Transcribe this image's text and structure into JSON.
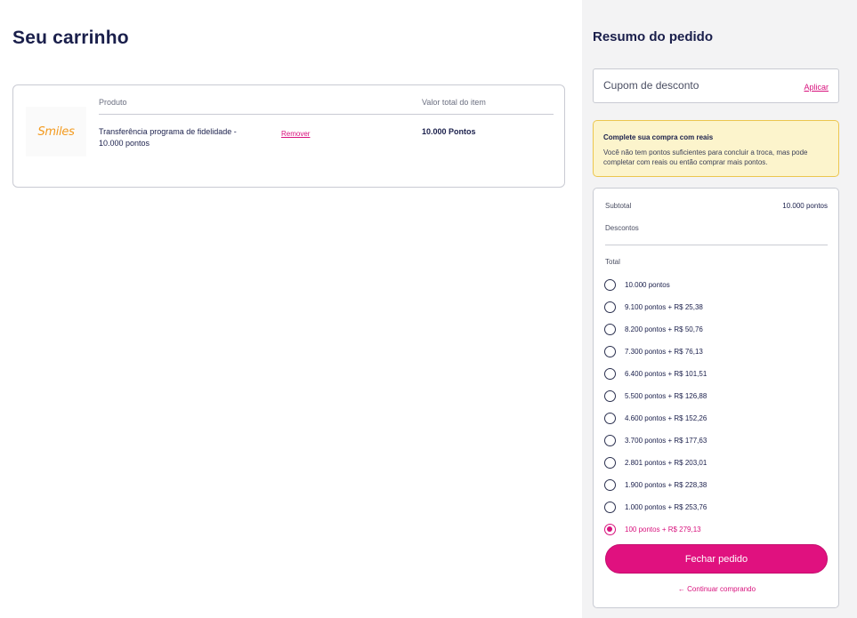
{
  "cart": {
    "title": "Seu carrinho",
    "logo": {
      "text": "Smiles",
      "icon": "smiles-logo",
      "color": "#f39a1e"
    },
    "columns": {
      "product": "Produto",
      "total": "Valor total do item"
    },
    "item": {
      "name": "Transferência programa de fidelidade - 10.000 pontos",
      "remove_label": "Remover",
      "total": "10.000 Pontos"
    }
  },
  "summary": {
    "title": "Resumo do pedido",
    "coupon": {
      "placeholder": "Cupom de desconto",
      "apply_label": "Aplicar"
    },
    "alert": {
      "title": "Complete sua compra com reais",
      "text": "Você não tem pontos suficientes para concluir a troca, mas pode completar com reais ou então comprar mais pontos."
    },
    "subtotal_label": "Subtotal",
    "subtotal_value": "10.000 pontos",
    "discounts_label": "Descontos",
    "total_label": "Total",
    "options": [
      {
        "label": "10.000 pontos",
        "selected": false
      },
      {
        "label": "9.100 pontos + R$ 25,38",
        "selected": false
      },
      {
        "label": "8.200 pontos + R$ 50,76",
        "selected": false
      },
      {
        "label": "7.300 pontos + R$ 76,13",
        "selected": false
      },
      {
        "label": "6.400 pontos + R$ 101,51",
        "selected": false
      },
      {
        "label": "5.500 pontos + R$ 126,88",
        "selected": false
      },
      {
        "label": "4.600 pontos + R$ 152,26",
        "selected": false
      },
      {
        "label": "3.700 pontos + R$ 177,63",
        "selected": false
      },
      {
        "label": "2.801 pontos + R$ 203,01",
        "selected": false
      },
      {
        "label": "1.900 pontos + R$ 228,38",
        "selected": false
      },
      {
        "label": "1.000 pontos + R$ 253,76",
        "selected": false
      },
      {
        "label": "100 pontos + R$ 279,13",
        "selected": true
      }
    ],
    "checkout_label": "Fechar pedido",
    "continue_icon": "arrow-left-icon",
    "continue_label": "← Continuar comprando"
  },
  "colors": {
    "brand": "#e0117f",
    "link": "#d8127d",
    "text": "#1a1f4b",
    "alert_bg": "#fcf4cc",
    "alert_border": "#ecc64f",
    "panel_bg": "#f3f3f4"
  }
}
